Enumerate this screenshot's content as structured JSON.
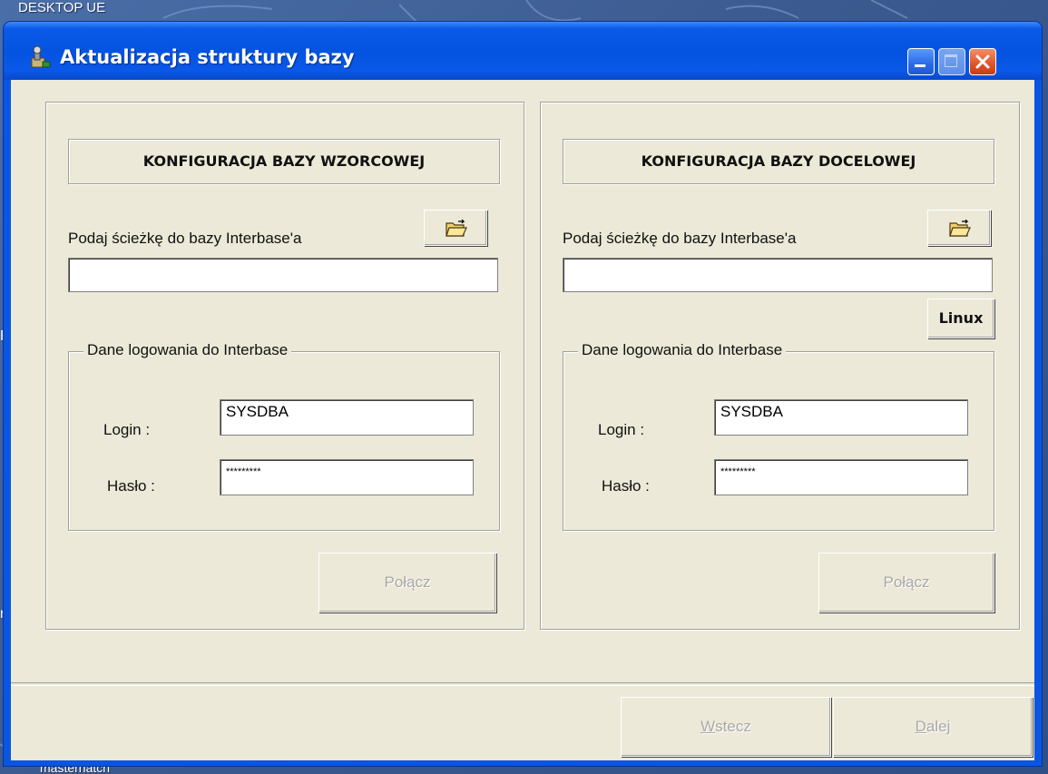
{
  "desktop": {
    "top_label": "DESKTOP UE",
    "bottom_label": "masternatch",
    "left_chars": [
      "F",
      "n"
    ]
  },
  "window": {
    "title": "Aktualizacja struktury bazy",
    "icon": "wrench-app-icon"
  },
  "source_panel": {
    "header": "KONFIGURACJA BAZY WZORCOWEJ",
    "path_label": "Podaj ścieżkę do bazy Interbase'a",
    "path_value": "",
    "browse_icon": "open-folder-icon",
    "group_title": "Dane logowania do Interbase",
    "login_label": "Login :",
    "login_value": "SYSDBA",
    "password_label": "Hasło :",
    "password_value": "*********",
    "connect_label": "Połącz"
  },
  "target_panel": {
    "header": "KONFIGURACJA BAZY DOCELOWEJ",
    "path_label": "Podaj ścieżkę do bazy Interbase'a",
    "path_value": "",
    "browse_icon": "open-folder-icon",
    "linux_label": "Linux",
    "group_title": "Dane logowania do Interbase",
    "login_label": "Login :",
    "login_value": "SYSDBA",
    "password_label": "Hasło :",
    "password_value": "*********",
    "connect_label": "Połącz"
  },
  "footer": {
    "back_label_mnemonic": "W",
    "back_label_rest": "stecz",
    "next_label_mnemonic": "D",
    "next_label_rest": "alej"
  }
}
